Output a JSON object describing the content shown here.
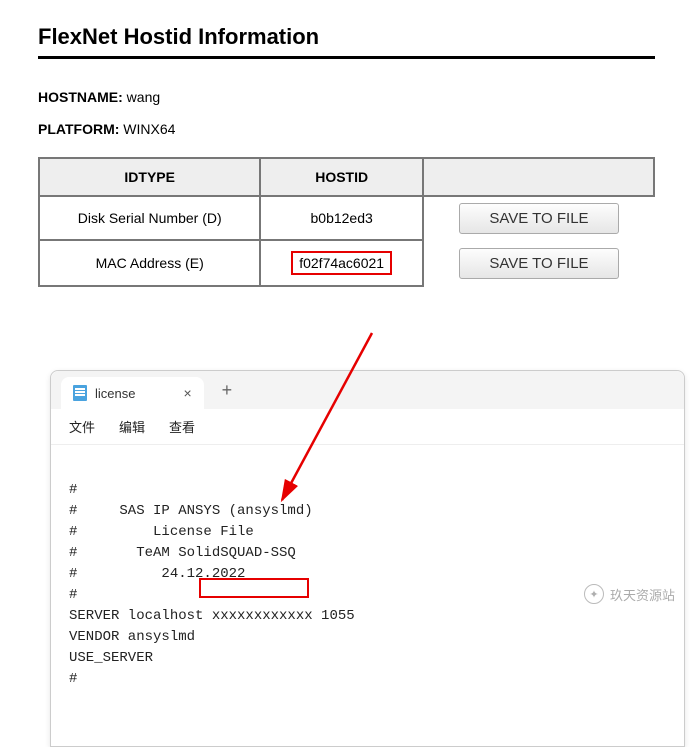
{
  "title": "FlexNet Hostid Information",
  "hostname_label": "HOSTNAME:",
  "hostname_value": "wang",
  "platform_label": "PLATFORM:",
  "platform_value": "WINX64",
  "table": {
    "headers": {
      "idtype": "IDTYPE",
      "hostid": "HOSTID"
    },
    "rows": [
      {
        "idtype": "Disk Serial Number (D)",
        "hostid": "b0b12ed3",
        "button": "SAVE TO FILE",
        "highlight": false
      },
      {
        "idtype": "MAC Address (E)",
        "hostid": "f02f74ac6021",
        "button": "SAVE TO FILE",
        "highlight": true
      }
    ]
  },
  "notepad": {
    "tab_title": "license",
    "tab_close": "×",
    "tab_add": "+",
    "menu": {
      "file": "文件",
      "edit": "编辑",
      "view": "查看"
    },
    "lines": {
      "l0": "#",
      "l1": "#     SAS IP ANSYS (ansyslmd)",
      "l2": "#         License File",
      "l3": "#       TeAM SolidSQUAD-SSQ",
      "l4": "#          24.12.2022",
      "l5": "#",
      "l6": "SERVER localhost xxxxxxxxxxxx 1055",
      "l7": "VENDOR ansyslmd",
      "l8": "USE_SERVER",
      "l9": "#"
    }
  },
  "watermark": {
    "text": "玖天资源站"
  },
  "annotation": {
    "highlight_color": "#e60000"
  }
}
